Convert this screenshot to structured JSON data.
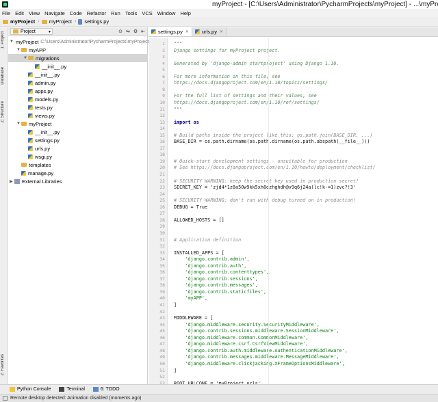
{
  "window": {
    "title": "myProject - [C:\\Users\\Administrator\\PycharmProjects\\myProject] - ...\\myProject\\"
  },
  "menu": [
    "File",
    "Edit",
    "View",
    "Navigate",
    "Code",
    "Refactor",
    "Run",
    "Tools",
    "VCS",
    "Window",
    "Help"
  ],
  "breadcrumb": [
    "myProject",
    "myProject",
    "settings.py"
  ],
  "left_stripe": [
    "1: Project",
    "Database",
    "Z: Structure",
    "2: Favorites"
  ],
  "project_panel": {
    "selector": "Project"
  },
  "tree": [
    {
      "name": "myProject",
      "suffix": "C:\\Users\\Administrator\\PycharmProjects\\myProject",
      "depth": 0,
      "icon": "folder-icon",
      "arrow": "▼"
    },
    {
      "name": "myAPP",
      "suffix": "",
      "depth": 1,
      "icon": "folder-icon",
      "arrow": "▼"
    },
    {
      "name": "migrations",
      "suffix": "",
      "depth": 2,
      "icon": "folder-icon",
      "arrow": "▼"
    },
    {
      "name": "__init__.py",
      "suffix": "",
      "depth": 3,
      "icon": "python-file-icon",
      "arrow": ""
    },
    {
      "name": "__init__.py",
      "suffix": "",
      "depth": 2,
      "icon": "python-file-icon",
      "arrow": ""
    },
    {
      "name": "admin.py",
      "suffix": "",
      "depth": 2,
      "icon": "python-file-icon",
      "arrow": ""
    },
    {
      "name": "apps.py",
      "suffix": "",
      "depth": 2,
      "icon": "python-file-icon",
      "arrow": ""
    },
    {
      "name": "models.py",
      "suffix": "",
      "depth": 2,
      "icon": "python-file-icon",
      "arrow": ""
    },
    {
      "name": "tests.py",
      "suffix": "",
      "depth": 2,
      "icon": "python-file-icon",
      "arrow": ""
    },
    {
      "name": "views.py",
      "suffix": "",
      "depth": 2,
      "icon": "python-file-icon",
      "arrow": ""
    },
    {
      "name": "myProject",
      "suffix": "",
      "depth": 1,
      "icon": "folder-icon",
      "arrow": "▼"
    },
    {
      "name": "__init__.py",
      "suffix": "",
      "depth": 2,
      "icon": "python-file-icon",
      "arrow": ""
    },
    {
      "name": "settings.py",
      "suffix": "",
      "depth": 2,
      "icon": "python-file-icon",
      "arrow": ""
    },
    {
      "name": "urls.py",
      "suffix": "",
      "depth": 2,
      "icon": "python-file-icon",
      "arrow": ""
    },
    {
      "name": "wsgi.py",
      "suffix": "",
      "depth": 2,
      "icon": "python-file-icon",
      "arrow": ""
    },
    {
      "name": "templates",
      "suffix": "",
      "depth": 1,
      "icon": "folder-icon",
      "arrow": ""
    },
    {
      "name": "manage.py",
      "suffix": "",
      "depth": 1,
      "icon": "python-file-icon",
      "arrow": ""
    },
    {
      "name": "External Libraries",
      "suffix": "",
      "depth": 0,
      "icon": "library-icon",
      "arrow": "▶"
    }
  ],
  "selected_tree_index": 2,
  "tabs": [
    {
      "label": "settings.py",
      "active": true
    },
    {
      "label": "urls.py",
      "active": false
    }
  ],
  "code_lines": [
    {
      "n": "1",
      "text": "\"\"\"",
      "style": "doc"
    },
    {
      "n": "2",
      "text": "Django settings for myProject project.",
      "style": "doc"
    },
    {
      "n": "3",
      "text": "",
      "style": ""
    },
    {
      "n": "4",
      "text": "Generated by 'django-admin startproject' using Django 1.10.",
      "style": "doc"
    },
    {
      "n": "5",
      "text": "",
      "style": ""
    },
    {
      "n": "6",
      "text": "For more information on this file, see",
      "style": "doc"
    },
    {
      "n": "7",
      "text": "https://docs.djangoproject.com/en/1.10/topics/settings/",
      "style": "doc"
    },
    {
      "n": "8",
      "text": "",
      "style": ""
    },
    {
      "n": "9",
      "text": "For the full list of settings and their values, see",
      "style": "doc"
    },
    {
      "n": "10",
      "text": "https://docs.djangoproject.com/en/1.10/ref/settings/",
      "style": "doc"
    },
    {
      "n": "11",
      "text": "\"\"\"",
      "style": "doc"
    },
    {
      "n": "12",
      "text": "",
      "style": ""
    },
    {
      "n": "13",
      "text": "import os",
      "style": "kw"
    },
    {
      "n": "14",
      "text": "",
      "style": ""
    },
    {
      "n": "15",
      "text": "# Build paths inside the project like this: os.path.join(BASE_DIR, ...)",
      "style": "com"
    },
    {
      "n": "16",
      "text": "BASE_DIR = os.path.dirname(os.path.dirname(os.path.abspath(__file__)))",
      "style": ""
    },
    {
      "n": "17",
      "text": "",
      "style": ""
    },
    {
      "n": "18",
      "text": "",
      "style": ""
    },
    {
      "n": "19",
      "text": "# Quick-start development settings - unsuitable for production",
      "style": "com"
    },
    {
      "n": "20",
      "text": "# See https://docs.djangoproject.com/en/1.10/howto/deployment/checklist/",
      "style": "com"
    },
    {
      "n": "21",
      "text": "",
      "style": ""
    },
    {
      "n": "22",
      "text": "# SECURITY WARNING: keep the secret key used in production secret!",
      "style": "com"
    },
    {
      "n": "23",
      "text": "SECRET_KEY = 'zjd4*1z8a50w9kk5xh8ozhghdh@v9q6j24a)lc!k-=1)zvc?!3'",
      "style": ""
    },
    {
      "n": "24",
      "text": "",
      "style": ""
    },
    {
      "n": "25",
      "text": "# SECURITY WARNING: don't run with debug turned on in production!",
      "style": "com"
    },
    {
      "n": "26",
      "text": "DEBUG = True",
      "style": ""
    },
    {
      "n": "27",
      "text": "",
      "style": ""
    },
    {
      "n": "28",
      "text": "ALLOWED_HOSTS = []",
      "style": ""
    },
    {
      "n": "29",
      "text": "",
      "style": ""
    },
    {
      "n": "30",
      "text": "",
      "style": ""
    },
    {
      "n": "31",
      "text": "# Application definition",
      "style": "com"
    },
    {
      "n": "32",
      "text": "",
      "style": ""
    },
    {
      "n": "33",
      "text": "INSTALLED_APPS = [",
      "style": ""
    },
    {
      "n": "34",
      "text": "    'django.contrib.admin',",
      "style": "str"
    },
    {
      "n": "35",
      "text": "    'django.contrib.auth',",
      "style": "str"
    },
    {
      "n": "36",
      "text": "    'django.contrib.contenttypes',",
      "style": "str"
    },
    {
      "n": "37",
      "text": "    'django.contrib.sessions',",
      "style": "str"
    },
    {
      "n": "38",
      "text": "    'django.contrib.messages',",
      "style": "str"
    },
    {
      "n": "39",
      "text": "    'django.contrib.staticfiles',",
      "style": "str"
    },
    {
      "n": "40",
      "text": "    'myAPP',",
      "style": "str"
    },
    {
      "n": "41",
      "text": "]",
      "style": ""
    },
    {
      "n": "42",
      "text": "",
      "style": ""
    },
    {
      "n": "43",
      "text": "MIDDLEWARE = [",
      "style": ""
    },
    {
      "n": "44",
      "text": "    'django.middleware.security.SecurityMiddleware',",
      "style": "str"
    },
    {
      "n": "45",
      "text": "    'django.contrib.sessions.middleware.SessionMiddleware',",
      "style": "str"
    },
    {
      "n": "46",
      "text": "    'django.middleware.common.CommonMiddleware',",
      "style": "str"
    },
    {
      "n": "47",
      "text": "    'django.middleware.csrf.CsrfViewMiddleware',",
      "style": "str"
    },
    {
      "n": "48",
      "text": "    'django.contrib.auth.middleware.AuthenticationMiddleware',",
      "style": "str"
    },
    {
      "n": "49",
      "text": "    'django.contrib.messages.middleware.MessageMiddleware',",
      "style": "str"
    },
    {
      "n": "50",
      "text": "    'django.middleware.clickjacking.XFrameOptionsMiddleware',",
      "style": "str"
    },
    {
      "n": "51",
      "text": "]",
      "style": ""
    },
    {
      "n": "52",
      "text": "",
      "style": ""
    },
    {
      "n": "53",
      "text": "ROOT_URLCONF = 'myProject.urls'",
      "style": ""
    }
  ],
  "bottom_tools": [
    {
      "label": "Python Console",
      "icon": "python-console-icon"
    },
    {
      "label": "Terminal",
      "icon": "terminal-icon"
    },
    {
      "label": "6: TODO",
      "icon": "todo-icon"
    }
  ],
  "status": {
    "message": "Remote desktop detected: Animation disabled (moments ago)"
  },
  "colors": {
    "docstring": "#5e8a62",
    "comment": "#8c8c8c",
    "string": "#0a7d13",
    "keyword": "#000080"
  }
}
